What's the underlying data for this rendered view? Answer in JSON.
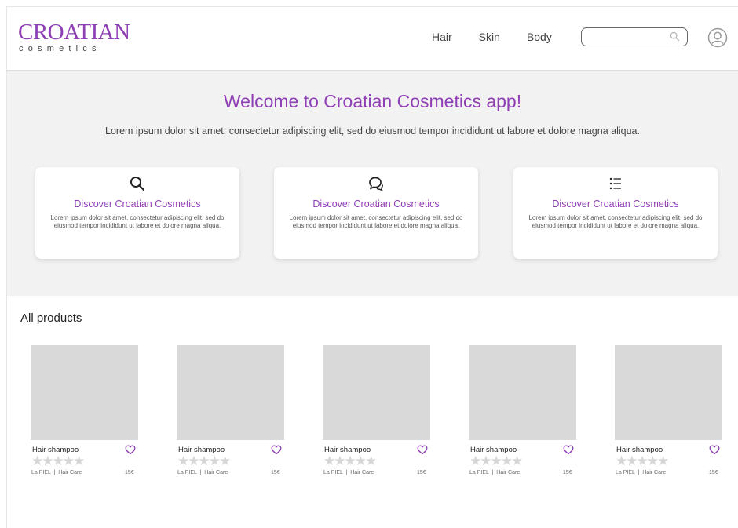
{
  "header": {
    "logo_main": "CROATIAN",
    "logo_sub": "cosmetics",
    "nav": [
      "Hair",
      "Skin",
      "Body"
    ],
    "search": {
      "value": "",
      "placeholder": ""
    }
  },
  "hero": {
    "title": "Welcome to Croatian Cosmetics app!",
    "subtitle": "Lorem ipsum dolor sit amet, consectetur adipiscing elit, sed do eiusmod tempor incididunt ut labore et dolore magna aliqua."
  },
  "cards": [
    {
      "icon": "search-icon",
      "title": "Discover Croatian Cosmetics",
      "body": "Lorem ipsum dolor sit amet, consectetur adipiscing elit, sed do eiusmod tempor incididunt ut labore et dolore magna aliqua."
    },
    {
      "icon": "chat-icon",
      "title": "Discover Croatian Cosmetics",
      "body": "Lorem ipsum dolor sit amet, consectetur adipiscing elit, sed do eiusmod tempor incididunt ut labore et dolore magna aliqua."
    },
    {
      "icon": "list-icon",
      "title": "Discover Croatian Cosmetics",
      "body": "Lorem ipsum dolor sit amet, consectetur adipiscing elit, sed do eiusmod tempor incididunt ut labore et dolore magna aliqua."
    }
  ],
  "products_section": {
    "title": "All products",
    "items": [
      {
        "name": "Hair shampoo",
        "brand": "La PIEL",
        "category": "Hair Care",
        "price": "15€",
        "rating": 0
      },
      {
        "name": "Hair shampoo",
        "brand": "La PIEL",
        "category": "Hair Care",
        "price": "15€",
        "rating": 0
      },
      {
        "name": "Hair shampoo",
        "brand": "La PIEL",
        "category": "Hair Care",
        "price": "15€",
        "rating": 0
      },
      {
        "name": "Hair shampoo",
        "brand": "La PIEL",
        "category": "Hair Care",
        "price": "15€",
        "rating": 0
      },
      {
        "name": "Hair shampoo",
        "brand": "La PIEL",
        "category": "Hair Care",
        "price": "15€",
        "rating": 0
      }
    ]
  },
  "colors": {
    "accent": "#8e3fb4",
    "hero_bg": "#f2f2f2",
    "placeholder_image": "#d9d9d9",
    "star_empty": "#d6d6d6"
  },
  "icons": {
    "search": "search-icon",
    "user": "user-circle-icon",
    "favorite": "heart-icon",
    "rating": "star-icon"
  }
}
